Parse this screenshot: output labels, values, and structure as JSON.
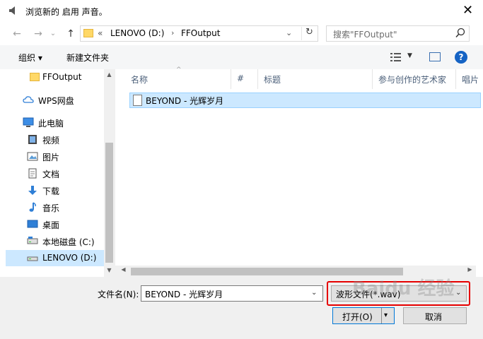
{
  "window": {
    "title": "浏览新的 启用 声音。",
    "close_glyph": "✕"
  },
  "nav": {
    "back": "←",
    "forward": "→",
    "recent": "⌄",
    "up": "↑",
    "address": {
      "overflow": "«",
      "drive": "LENOVO (D:)",
      "folder": "FFOutput",
      "separator": "›",
      "dropdown": "⌄",
      "refresh": "↻"
    },
    "search_placeholder": "搜索\"FFOutput\""
  },
  "toolbar": {
    "organize": "组织 ▾",
    "new_folder": "新建文件夹",
    "view_dropdown": "▼",
    "help": "?"
  },
  "sidebar": {
    "items": [
      {
        "label": "FFOutput",
        "icon": "folder-icon"
      },
      {
        "label": "WPS网盘",
        "icon": "cloud-icon"
      },
      {
        "label": "此电脑",
        "icon": "computer-icon"
      },
      {
        "label": "视频",
        "icon": "video-icon"
      },
      {
        "label": "图片",
        "icon": "picture-icon"
      },
      {
        "label": "文档",
        "icon": "document-icon"
      },
      {
        "label": "下载",
        "icon": "download-icon"
      },
      {
        "label": "音乐",
        "icon": "music-icon"
      },
      {
        "label": "桌面",
        "icon": "desktop-icon"
      },
      {
        "label": "本地磁盘 (C:)",
        "icon": "drive-icon"
      },
      {
        "label": "LENOVO (D:)",
        "icon": "drive-icon",
        "selected": true
      }
    ]
  },
  "columns": [
    "名称",
    "#",
    "标题",
    "参与创作的艺术家",
    "唱片"
  ],
  "sort_indicator": "^",
  "files": [
    {
      "name": "BEYOND - 光辉岁月"
    }
  ],
  "scroll_arrows": {
    "up": "▲",
    "down": "▼",
    "left": "◀",
    "right": "▶"
  },
  "bottom": {
    "filename_label": "文件名(N):",
    "filename_value": "BEYOND - 光辉岁月",
    "dropdown": "⌄",
    "filetype": "波形文件(*.wav)",
    "open_label": "打开(O)",
    "open_dropdown": "▾",
    "cancel_label": "取消"
  },
  "watermark": "Baidu 经验",
  "colors": {
    "selection": "#cce8ff",
    "accent": "#0078d7",
    "highlight_box": "#e60000",
    "help": "#1563c4"
  }
}
